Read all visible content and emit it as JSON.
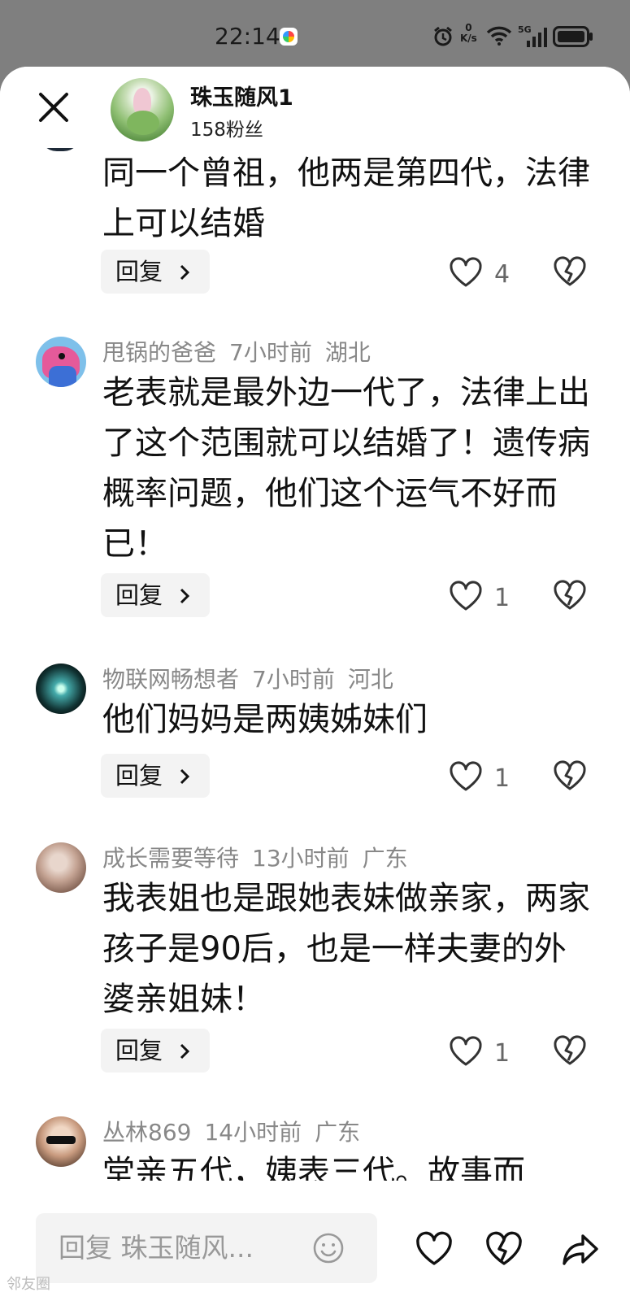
{
  "status_bar": {
    "time": "22:14",
    "net_speed_value": "0",
    "net_speed_unit": "K/s",
    "network": "5G"
  },
  "header": {
    "name": "珠玉随风1",
    "fans": "158粉丝"
  },
  "first_comment": {
    "text": "同一个曾祖，他两是第四代，法律上可以结婚",
    "likes": "4"
  },
  "comments": [
    {
      "user": "甩锅的爸爸",
      "time": "7小时前",
      "location": "湖北",
      "text": "老表就是最外边一代了，法律上出了这个范围就可以结婚了！遗传病概率问题，他们这个运气不好而已！",
      "likes": "1"
    },
    {
      "user": "物联网畅想者",
      "time": "7小时前",
      "location": "河北",
      "text": "他们妈妈是两姨姊妹们",
      "likes": "1"
    },
    {
      "user": "成长需要等待",
      "time": "13小时前",
      "location": "广东",
      "text": "我表姐也是跟她表妹做亲家，两家孩子是90后，也是一样夫妻的外婆亲姐妹！",
      "likes": "1"
    },
    {
      "user": "丛林869",
      "time": "14小时前",
      "location": "广东",
      "text": "堂亲五代，姨表三代。故事而"
    }
  ],
  "reply_label": "回复",
  "bottom_bar": {
    "placeholder": "回复 珠玉随风..."
  },
  "watermark": "邻友圈",
  "colors": {
    "meta": "#888888",
    "reply_bg": "#f3f3f3",
    "status_bg": "#7f7f7f"
  }
}
